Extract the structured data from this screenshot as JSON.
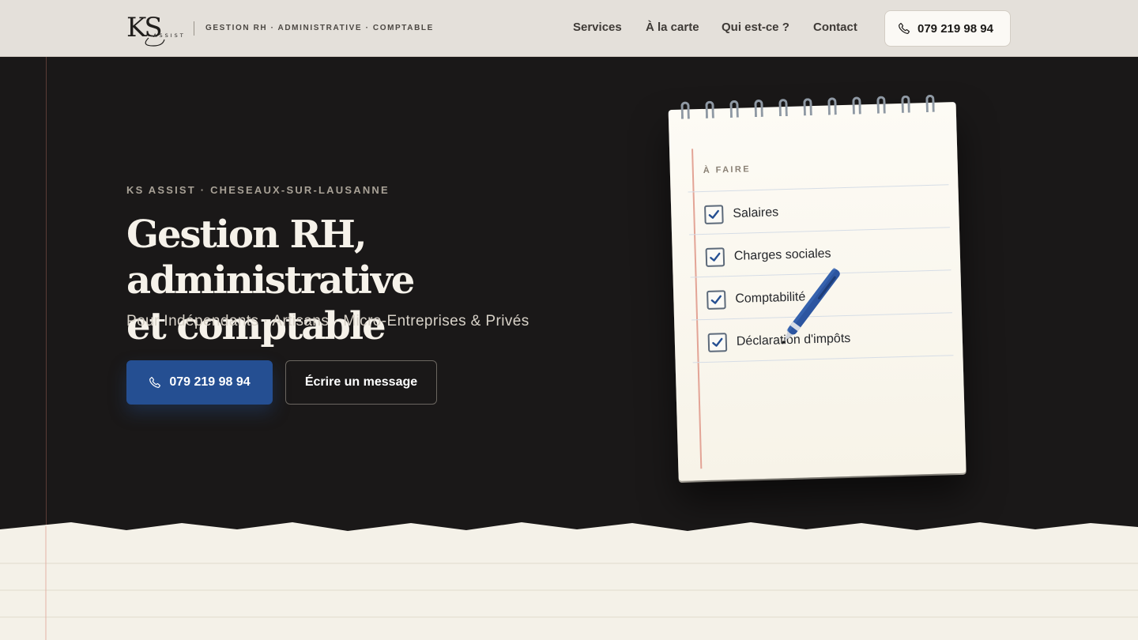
{
  "header": {
    "logo_text": "KS ASSIST",
    "tagline": "GESTION RH · ADMINISTRATIVE · COMPTABLE",
    "nav": [
      "Services",
      "À la carte",
      "Qui est-ce ?",
      "Contact"
    ],
    "phone": "079 219 98 94"
  },
  "hero": {
    "eyebrow": "KS ASSIST · CHESEAUX-SUR-LAUSANNE",
    "title_line1": "Gestion RH, administrative",
    "title_line2": "et comptable",
    "subtitle": "Pour Indépendants · Artisans · Micro-Entreprises & Privés",
    "primary_button": "079 219 98 94",
    "secondary_button": "Écrire un message"
  },
  "notepad": {
    "heading": "À FAIRE",
    "items": [
      "Salaires",
      "Charges sociales",
      "Comptabilité",
      "Déclaration d'impôts"
    ]
  },
  "colors": {
    "header_bg": "#e4e0da",
    "hero_bg": "#1a1818",
    "primary_blue": "#254f92",
    "paper": "#f4f1e8"
  }
}
